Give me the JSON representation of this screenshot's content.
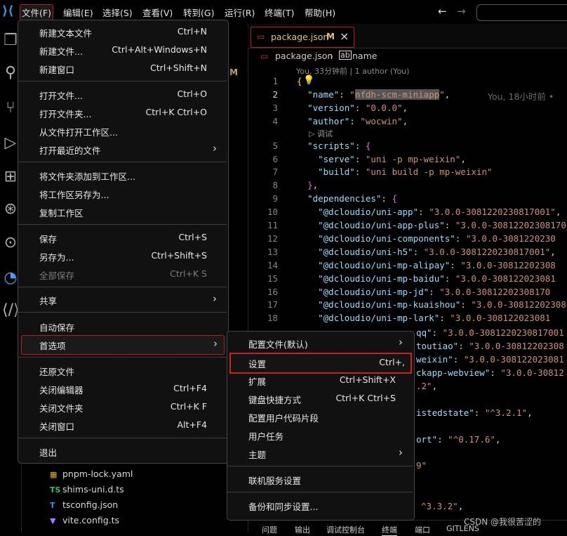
{
  "titlebar": {
    "menus": [
      "文件(F)",
      "编辑(E)",
      "选择(S)",
      "查看(V)",
      "转到(G)",
      "运行(R)",
      "终端(T)",
      "帮助(H)"
    ],
    "back_arrow": "←",
    "forward_arrow": "→"
  },
  "file_menu": {
    "new_text_file": {
      "label": "新建文本文件",
      "shortcut": "Ctrl+N"
    },
    "new_file": {
      "label": "新建文件...",
      "shortcut": "Ctrl+Alt+Windows+N"
    },
    "new_window": {
      "label": "新建窗口",
      "shortcut": "Ctrl+Shift+N"
    },
    "open_file": {
      "label": "打开文件...",
      "shortcut": "Ctrl+O"
    },
    "open_folder": {
      "label": "打开文件夹...",
      "shortcut": "Ctrl+K Ctrl+O"
    },
    "open_workspace": {
      "label": "从文件打开工作区..."
    },
    "open_recent": {
      "label": "打开最近的文件"
    },
    "add_folder": {
      "label": "将文件夹添加到工作区..."
    },
    "save_workspace_as": {
      "label": "将工作区另存为..."
    },
    "duplicate_workspace": {
      "label": "复制工作区"
    },
    "save": {
      "label": "保存",
      "shortcut": "Ctrl+S"
    },
    "save_as": {
      "label": "另存为...",
      "shortcut": "Ctrl+Shift+S"
    },
    "save_all": {
      "label": "全部保存",
      "shortcut": "Ctrl+K S"
    },
    "share": {
      "label": "共享"
    },
    "auto_save": {
      "label": "自动保存"
    },
    "preferences": {
      "label": "首选项"
    },
    "revert_file": {
      "label": "还原文件"
    },
    "close_editor": {
      "label": "关闭编辑器",
      "shortcut": "Ctrl+F4"
    },
    "close_folder": {
      "label": "关闭文件夹",
      "shortcut": "Ctrl+K F"
    },
    "close_window": {
      "label": "关闭窗口",
      "shortcut": "Alt+F4"
    },
    "exit": {
      "label": "退出"
    }
  },
  "preferences_menu": {
    "profiles": {
      "label": "配置文件(默认)"
    },
    "settings": {
      "label": "设置",
      "shortcut": "Ctrl+,"
    },
    "extensions": {
      "label": "扩展",
      "shortcut": "Ctrl+Shift+X"
    },
    "keyboard_shortcuts": {
      "label": "键盘快捷方式",
      "shortcut": "Ctrl+K Ctrl+S"
    },
    "user_snippets": {
      "label": "配置用户代码片段"
    },
    "user_tasks": {
      "label": "用户任务"
    },
    "themes": {
      "label": "主题"
    },
    "online_services": {
      "label": "联机服务设置"
    },
    "backup_sync": {
      "label": "备份和同步设置..."
    }
  },
  "explorer": {
    "modified_badge": "M",
    "files": [
      {
        "icon": "▦",
        "name": "pnpm-lock.yaml"
      },
      {
        "icon": "TS",
        "name": "shims-uni.d.ts"
      },
      {
        "icon": "T",
        "name": "tsconfig.json"
      },
      {
        "icon": "▼",
        "name": "vite.config.ts"
      }
    ]
  },
  "editor": {
    "tab_label": "package.json",
    "tab_modified": "M",
    "tab_close": "×",
    "breadcrumb_file": "package.json",
    "breadcrumb_symbol": "name",
    "blame_header": "You, 33分钟前 | 1 author (You)",
    "inline_blame": "You, 18小时前 •",
    "debug_codelens": "调试",
    "lines": [
      {
        "n": "1",
        "code": "{"
      },
      {
        "n": "2",
        "code": "  \"name\": \"nfdh-scm-miniapp\","
      },
      {
        "n": "3",
        "code": "  \"version\": \"0.0.0\","
      },
      {
        "n": "4",
        "code": "  \"author\": \"wocwin\","
      },
      {
        "n": "5",
        "code": "  \"scripts\": {"
      },
      {
        "n": "6",
        "code": "    \"serve\": \"uni -p mp-weixin\","
      },
      {
        "n": "7",
        "code": "    \"build\": \"uni build -p mp-weixin\""
      },
      {
        "n": "8",
        "code": "  },"
      },
      {
        "n": "9",
        "code": "  \"dependencies\": {"
      },
      {
        "n": "10",
        "code": "    \"@dcloudio/uni-app\": \"3.0.0-3081220230817001\","
      },
      {
        "n": "11",
        "code": "    \"@dcloudio/uni-app-plus\": \"3.0.0-30812202308170"
      },
      {
        "n": "12",
        "code": "    \"@dcloudio/uni-components\": \"3.0.0-3081220230"
      },
      {
        "n": "13",
        "code": "    \"@dcloudio/uni-h5\": \"3.0.0-3081220230817001\","
      },
      {
        "n": "14",
        "code": "    \"@dcloudio/uni-mp-alipay\": \"3.0.0-30812202308"
      },
      {
        "n": "15",
        "code": "    \"@dcloudio/uni-mp-baidu\": \"3.0.0-308122023081"
      },
      {
        "n": "16",
        "code": "    \"@dcloudio/uni-mp-jd\": \"3.0.0-30812202308170"
      },
      {
        "n": "17",
        "code": "    \"@dcloudio/uni-mp-kuaishou\": \"3.0.0-30812202308"
      },
      {
        "n": "18",
        "code": "    \"@dcloudio/uni-mp-lark\": \"3.0.0-308122023081"
      }
    ],
    "fragments": [
      "qq\": \"3.0.0-3081220230817001",
      "toutiao\": \"3.0.0-30812202308",
      "weixin\": \"3.0.0-308122023081",
      "ckapp-webview\": \"3.0.0-30812",
      ".2\",",
      "istedstate\": \"^3.2.1\",",
      "ort\": \"^0.17.6\",",
      "9\"",
      "\"^3.3.2\","
    ]
  },
  "panel": {
    "tabs": [
      "问题",
      "输出",
      "调试控制台",
      "终端",
      "端口",
      "GITLENS"
    ]
  },
  "watermark": "CSDN @我很苦涩的"
}
